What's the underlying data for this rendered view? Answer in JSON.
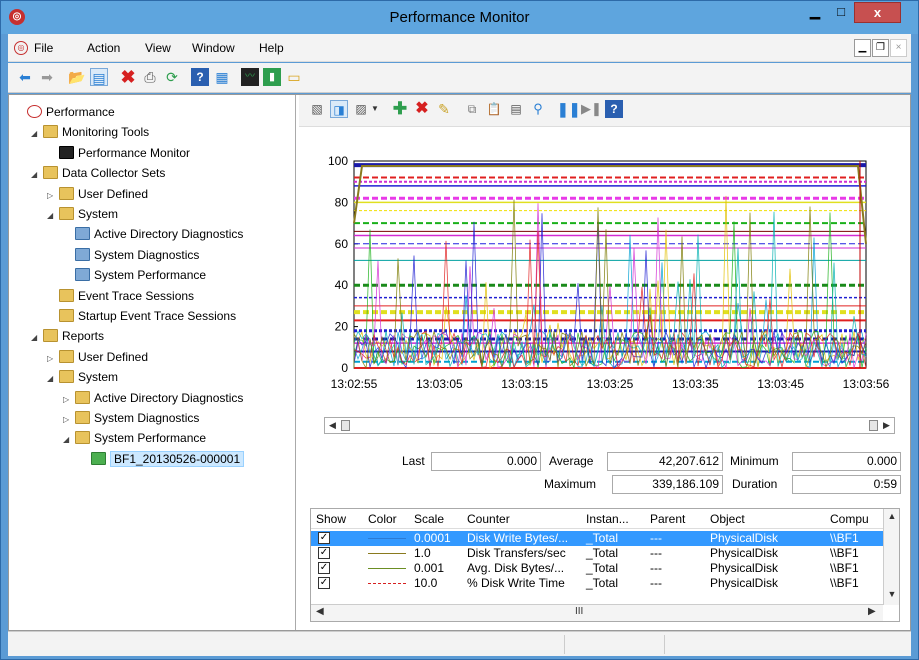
{
  "window": {
    "title": "Performance Monitor",
    "min": "▁",
    "max": "□",
    "close": "x"
  },
  "menu": {
    "items": [
      "File",
      "Action",
      "View",
      "Window",
      "Help"
    ]
  },
  "tree": {
    "nodes": [
      {
        "label": "Performance",
        "level": 0,
        "exp": "",
        "icon": "perfic"
      },
      {
        "label": "Monitoring Tools",
        "level": 1,
        "exp": "◢",
        "icon": "f"
      },
      {
        "label": "Performance Monitor",
        "level": 2,
        "exp": "",
        "icon": "mon"
      },
      {
        "label": "Data Collector Sets",
        "level": 1,
        "exp": "◢",
        "icon": "f"
      },
      {
        "label": "User Defined",
        "level": 2,
        "exp": "▷",
        "icon": "f"
      },
      {
        "label": "System",
        "level": 2,
        "exp": "◢",
        "icon": "f"
      },
      {
        "label": "Active Directory Diagnostics",
        "level": 3,
        "exp": "",
        "icon": "dcs"
      },
      {
        "label": "System Diagnostics",
        "level": 3,
        "exp": "",
        "icon": "dcs"
      },
      {
        "label": "System Performance",
        "level": 3,
        "exp": "",
        "icon": "dcs"
      },
      {
        "label": "Event Trace Sessions",
        "level": 2,
        "exp": "",
        "icon": "f"
      },
      {
        "label": "Startup Event Trace Sessions",
        "level": 2,
        "exp": "",
        "icon": "f"
      },
      {
        "label": "Reports",
        "level": 1,
        "exp": "◢",
        "icon": "f"
      },
      {
        "label": "User Defined",
        "level": 2,
        "exp": "▷",
        "icon": "f"
      },
      {
        "label": "System",
        "level": 2,
        "exp": "◢",
        "icon": "f"
      },
      {
        "label": "Active Directory Diagnostics",
        "level": 3,
        "exp": "▷",
        "icon": "f"
      },
      {
        "label": "System Diagnostics",
        "level": 3,
        "exp": "▷",
        "icon": "f"
      },
      {
        "label": "System Performance",
        "level": 3,
        "exp": "◢",
        "icon": "f"
      },
      {
        "label": "BF1_20130526-000001",
        "level": 4,
        "exp": "",
        "icon": "rep",
        "selected": true
      }
    ]
  },
  "chart": {
    "y_ticks": [
      "100",
      "80",
      "60",
      "40",
      "20",
      "0"
    ],
    "x_ticks": [
      "13:02:55",
      "13:03:05",
      "13:03:15",
      "13:03:25",
      "13:03:35",
      "13:03:45",
      "13:03:56"
    ]
  },
  "stats": {
    "last_label": "Last",
    "last_value": "0.000",
    "avg_label": "Average",
    "avg_value": "42,207.612",
    "min_label": "Minimum",
    "min_value": "0.000",
    "max_label": "Maximum",
    "max_value": "339,186.109",
    "dur_label": "Duration",
    "dur_value": "0:59"
  },
  "table": {
    "headers": {
      "show": "Show",
      "color": "Color",
      "scale": "Scale",
      "counter": "Counter",
      "instance": "Instan...",
      "parent": "Parent",
      "object": "Object",
      "computer": "Compu"
    },
    "rows": [
      {
        "scale": "0.0001",
        "counter": "Disk Write Bytes/...",
        "instance": "_Total",
        "parent": "---",
        "object": "PhysicalDisk",
        "computer": "\\\\BF1",
        "color": "#2b7bd6",
        "dash": "solid",
        "selected": true
      },
      {
        "scale": "1.0",
        "counter": "Disk Transfers/sec",
        "instance": "_Total",
        "parent": "---",
        "object": "PhysicalDisk",
        "computer": "\\\\BF1",
        "color": "#8a7a1e",
        "dash": "solid",
        "selected": false
      },
      {
        "scale": "0.001",
        "counter": "Avg. Disk Bytes/...",
        "instance": "_Total",
        "parent": "---",
        "object": "PhysicalDisk",
        "computer": "\\\\BF1",
        "color": "#6b8e23",
        "dash": "solid",
        "selected": false
      },
      {
        "scale": "10.0",
        "counter": "% Disk Write Time",
        "instance": "_Total",
        "parent": "---",
        "object": "PhysicalDisk",
        "computer": "\\\\BF1",
        "color": "#d62020",
        "dash": "dashed",
        "selected": false
      }
    ],
    "scroll_mid": "III"
  },
  "colors": {
    "titlebar": "#5ea5de",
    "selection": "#3399ff",
    "close": "#c75050"
  },
  "icons": [
    "back-icon",
    "forward-icon",
    "up-folder-icon",
    "console-tree-icon",
    "delete-icon",
    "print-icon",
    "refresh-icon",
    "help-icon",
    "show-hide-icon",
    "performance-icon",
    "report-icon",
    "folder-icon",
    "view-graph-icon",
    "view-histogram-icon",
    "view-report-icon",
    "add-counter-icon",
    "delete-counter-icon",
    "highlight-icon",
    "copy-properties-icon",
    "paste-counter-list-icon",
    "properties-icon",
    "zoom-icon",
    "freeze-display-icon",
    "update-data-icon"
  ]
}
